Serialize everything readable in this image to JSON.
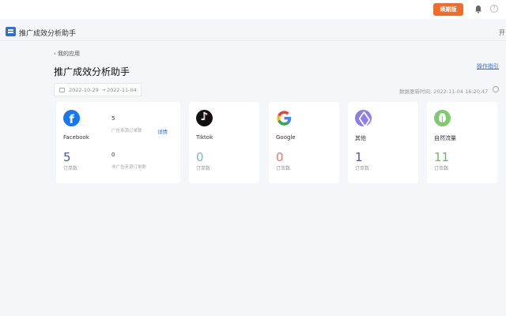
{
  "header": {
    "upgrade_label": "续期版",
    "help_glyph": "?"
  },
  "app": {
    "title": "推广成效分析助手",
    "right_label": "开"
  },
  "page": {
    "back_label": "我的应用",
    "title": "推广成效分析助手",
    "guide_label": "操作指引",
    "date_start": "2022-10-29",
    "date_sep": "→",
    "date_end": "2022-11-04",
    "update_time": "数据更新时间: 2022-11-04 16:20:47"
  },
  "cards": {
    "facebook": {
      "name": "Facebook",
      "count": "5",
      "count_label": "订单数",
      "ad_count": "5",
      "ad_label": "广告来源订单数",
      "detail_label": "详情",
      "non_ad_count": "0",
      "non_ad_label": "非广告来源订单数"
    },
    "tiktok": {
      "name": "Tiktok",
      "count": "0",
      "count_label": "订单数"
    },
    "google": {
      "name": "Google",
      "count": "0",
      "count_label": "订单数"
    },
    "other": {
      "name": "其他",
      "count": "1",
      "count_label": "订单数"
    },
    "organic": {
      "name": "自然流量",
      "count": "11",
      "count_label": "订单数"
    }
  },
  "colors": {
    "accent": "#f26b2a",
    "facebook": "#1877f2",
    "facebook_num": "#3b5bb5",
    "tiktok_num": "#7fb3d9",
    "google_num": "#e07a6d",
    "other_num": "#5b4aa8",
    "organic_num": "#6fba5a"
  }
}
